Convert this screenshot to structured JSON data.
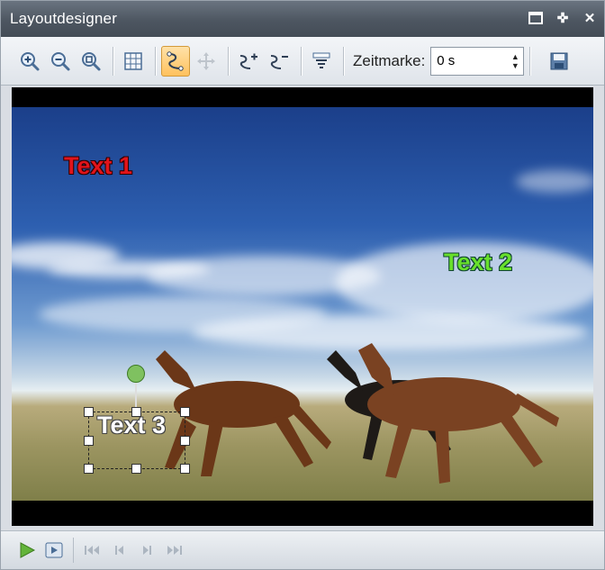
{
  "window": {
    "title": "Layoutdesigner",
    "title_buttons": [
      "minimize-icon",
      "pin-icon",
      "close-icon"
    ],
    "close_glyph": "✕",
    "pin_glyph": "✜"
  },
  "toolbar": {
    "buttons": [
      {
        "name": "zoom-in-icon"
      },
      {
        "name": "zoom-out-icon"
      },
      {
        "name": "zoom-fit-icon"
      },
      {
        "name": "grid-icon"
      },
      {
        "name": "motion-path-icon",
        "active": true
      },
      {
        "name": "move-icon",
        "disabled": true
      },
      {
        "name": "add-path-point-icon"
      },
      {
        "name": "remove-path-point-icon"
      },
      {
        "name": "align-icon"
      },
      {
        "name": "save-icon"
      }
    ],
    "zeitmarke_label": "Zeitmarke:",
    "zeitmarke_value": "0 s"
  },
  "canvas": {
    "text_objects": [
      {
        "label": "Text 1",
        "color": "#e1141b"
      },
      {
        "label": "Text 2",
        "color": "#68e02c"
      },
      {
        "label": "Text 3",
        "color": "#ffffff",
        "selected": true
      }
    ]
  },
  "playback": {
    "buttons": [
      "play-icon",
      "preview-icon",
      "skip-to-start-icon",
      "previous-frame-icon",
      "next-frame-icon",
      "skip-to-end-icon"
    ]
  },
  "colors": {
    "accent_active": "#ffc25e",
    "titlebar": "#4d5661"
  }
}
